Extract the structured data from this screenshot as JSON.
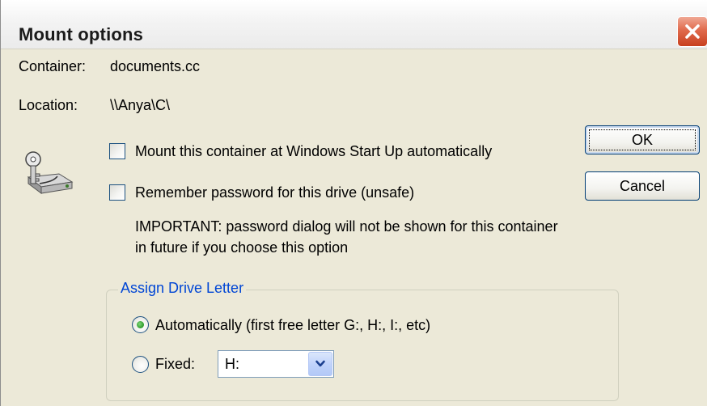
{
  "window": {
    "title": "Mount options",
    "close_icon": "close-x-icon"
  },
  "info": {
    "container_label": "Container:",
    "container_value": "documents.cc",
    "location_label": "Location:",
    "location_value": "\\\\Anya\\C\\"
  },
  "icon": {
    "name": "key-drive-icon"
  },
  "options": {
    "mount_startup_label": "Mount this container at Windows Start Up automatically",
    "mount_startup_checked": false,
    "remember_password_label": "Remember password for this drive (unsafe)",
    "remember_password_checked": false,
    "important_line1": "IMPORTANT: password dialog will not be shown for this container",
    "important_line2": "in future if you choose this option"
  },
  "buttons": {
    "ok_label": "OK",
    "cancel_label": "Cancel"
  },
  "drive_letter": {
    "group_title": "Assign Drive Letter",
    "auto_label": "Automatically (first free letter G:, H:, I:, etc)",
    "auto_selected": true,
    "fixed_label": "Fixed:",
    "fixed_selected": false,
    "fixed_value": "H:"
  },
  "colors": {
    "dialog_bg": "#ece9d8",
    "group_title": "#0046d5",
    "close_button": "#e06a4c"
  }
}
